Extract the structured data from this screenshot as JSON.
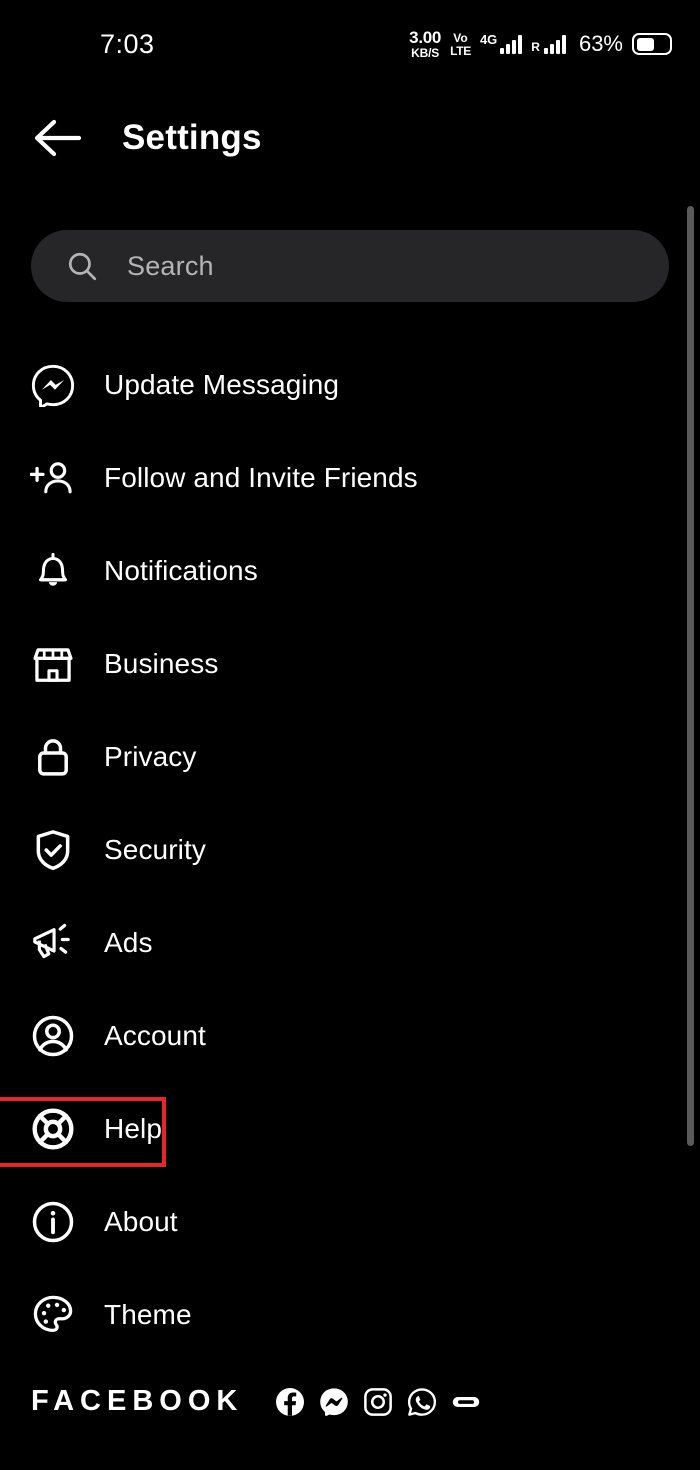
{
  "statusbar": {
    "time": "7:03",
    "net_speed_value": "3.00",
    "net_speed_unit": "KB/S",
    "volte_line1": "Vo",
    "volte_line2": "LTE",
    "network_type": "4G",
    "roaming_label": "R",
    "battery_percent": "63%",
    "battery_icon": "battery-icon"
  },
  "header": {
    "back_icon": "back-arrow-icon",
    "title": "Settings"
  },
  "search": {
    "icon": "search-icon",
    "placeholder": "Search",
    "value": ""
  },
  "menu": {
    "items": [
      {
        "label": "Update Messaging",
        "icon": "messenger-icon",
        "highlighted": false
      },
      {
        "label": "Follow and Invite Friends",
        "icon": "person-plus-icon",
        "highlighted": false
      },
      {
        "label": "Notifications",
        "icon": "bell-icon",
        "highlighted": false
      },
      {
        "label": "Business",
        "icon": "storefront-icon",
        "highlighted": false
      },
      {
        "label": "Privacy",
        "icon": "lock-icon",
        "highlighted": false
      },
      {
        "label": "Security",
        "icon": "shield-check-icon",
        "highlighted": false
      },
      {
        "label": "Ads",
        "icon": "megaphone-icon",
        "highlighted": false
      },
      {
        "label": "Account",
        "icon": "person-circle-icon",
        "highlighted": false
      },
      {
        "label": "Help",
        "icon": "lifebuoy-icon",
        "highlighted": true
      },
      {
        "label": "About",
        "icon": "info-circle-icon",
        "highlighted": false
      },
      {
        "label": "Theme",
        "icon": "palette-icon",
        "highlighted": false
      }
    ]
  },
  "footer": {
    "brand": "FACEBOOK",
    "social_icons": [
      "facebook-icon",
      "messenger-icon",
      "instagram-icon",
      "whatsapp-icon",
      "portal-icon"
    ]
  },
  "colors": {
    "background": "#000000",
    "search_field": "#262628",
    "text_primary": "#ffffff",
    "text_placeholder": "#b4b4b6",
    "highlight_box": "#e8252a",
    "scrollbar": "#5a5a5a"
  }
}
